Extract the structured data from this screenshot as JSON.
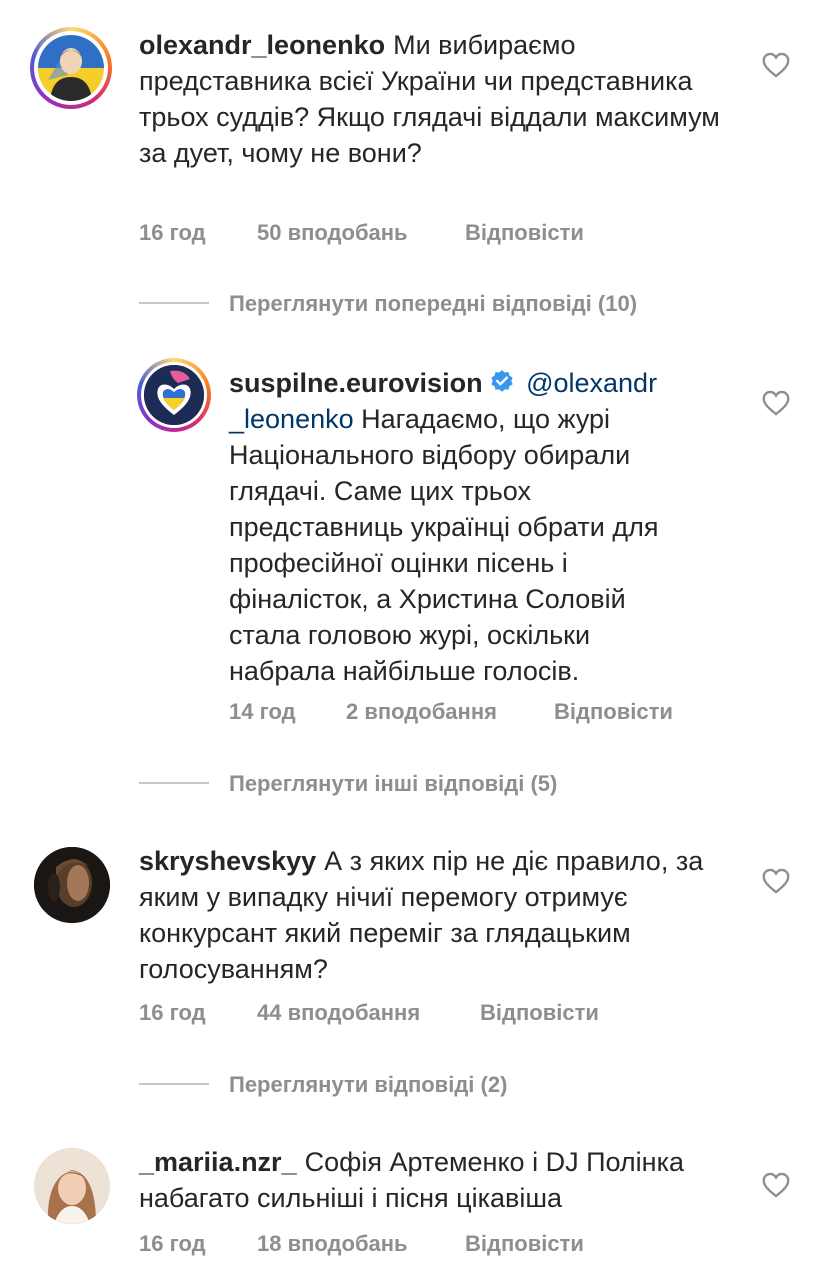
{
  "comments": [
    {
      "username": "olexandr_leonenko",
      "text": "Ми вибираємо представника всієї України чи представника трьох суддів? Якщо глядачі віддали максимум за дует, чому не вони?",
      "time": "16 год",
      "likes": "50 вподобань",
      "reply": "Відповісти"
    },
    {
      "username": "suspilne.eurovision",
      "mention": "@olexandr _leonenko",
      "text": "Нагадаємо, що журі Національного відбору обирали глядачі. Саме цих трьох представниць українці обрати для професійної оцінки пісень і фіналісток, а Христина Соловій стала головою журі, оскільки набрала найбільше голосів.",
      "time": "14 год",
      "likes": "2 вподобання",
      "reply": "Відповісти"
    },
    {
      "username": "skryshevskyy",
      "text": "А з яких пір не діє правило, за яким у випадку нічиї перемогу отримує конкурсант який переміг за глядацьким голосуванням?",
      "time": "16 год",
      "likes": "44 вподобання",
      "reply": "Відповісти"
    },
    {
      "username": "_mariia.nzr_",
      "text": "Софія Артеменко і DJ Полінка набагато сильніші і пісня цікавіша",
      "time": "16 год",
      "likes": "18 вподобань",
      "reply": "Відповісти"
    }
  ],
  "view_replies": {
    "prev": "Переглянути попередні відповіді (10)",
    "other": "Переглянути інші відповіді (5)",
    "replies": "Переглянути відповіді (2)"
  },
  "colors": {
    "meta": "#8e8e8e",
    "mention": "#00376b",
    "verified": "#3897f0"
  }
}
